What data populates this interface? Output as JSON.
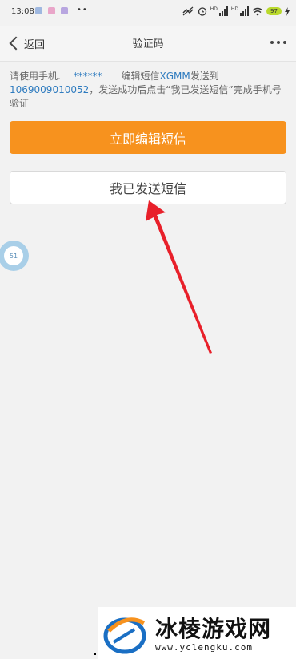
{
  "status_bar": {
    "time": "13:08",
    "battery": "97",
    "network_labels": [
      "HD",
      "HD"
    ]
  },
  "nav": {
    "back_label": "返回",
    "title": "验证码"
  },
  "instruction": {
    "p1": "请使用手机",
    "masked_phone": "******",
    "p2": "编辑短信",
    "keyword": "XGMM",
    "p3": "发送到",
    "number": "1069009010052",
    "p4": "，发送成功后点击“我已发送短信”完成手机号验证"
  },
  "buttons": {
    "edit_sms": "立即编辑短信",
    "sent_sms": "我已发送短信"
  },
  "float_bubble": {
    "label": "51"
  },
  "watermark": {
    "title": "冰棱游戏网",
    "url": "www.yclengku.com"
  },
  "colors": {
    "primary_orange": "#f7921e",
    "link_blue": "#2e7bbf",
    "arrow_red": "#e8202a",
    "background": "#f2f2f2"
  },
  "icons": [
    "back-chevron-icon",
    "more-dots-icon",
    "alarm-icon",
    "wifi-icon",
    "signal-icon",
    "battery-icon",
    "charging-icon"
  ]
}
